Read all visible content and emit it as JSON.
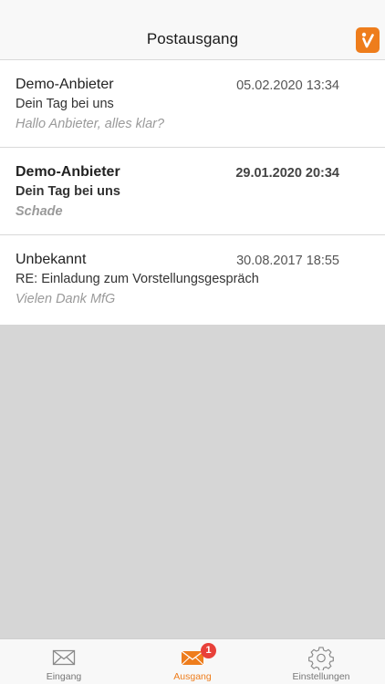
{
  "header": {
    "title": "Postausgang",
    "logo_icon": "brand-logo-icon",
    "accent_color": "#ee7d1c"
  },
  "messages": [
    {
      "sender": "Demo-Anbieter",
      "date": "05.02.2020 13:34",
      "subject": "Dein Tag bei uns",
      "preview": "Hallo Anbieter, alles klar?",
      "unread": false
    },
    {
      "sender": "Demo-Anbieter",
      "date": "29.01.2020 20:34",
      "subject": "Dein Tag bei uns",
      "preview": "Schade",
      "unread": true
    },
    {
      "sender": "Unbekannt",
      "date": "30.08.2017 18:55",
      "subject": "RE: Einladung zum Vorstellungsgespräch",
      "preview": "Vielen Dank MfG",
      "unread": false
    }
  ],
  "tabbar": {
    "items": [
      {
        "label": "Eingang",
        "icon": "envelope-icon",
        "active": false
      },
      {
        "label": "Ausgang",
        "icon": "envelope-outbox-icon",
        "active": true,
        "badge": "1"
      },
      {
        "label": "Einstellungen",
        "icon": "gear-icon",
        "active": false
      }
    ]
  }
}
